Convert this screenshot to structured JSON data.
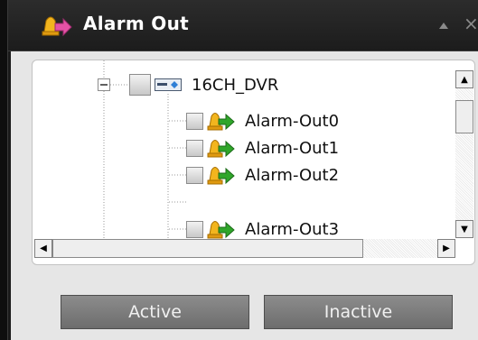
{
  "window": {
    "title": "Alarm Out",
    "collapse_icon": "triangle-up-icon",
    "close_icon": "close-icon",
    "close_glyph": "×"
  },
  "tree": {
    "root": {
      "label": "16CH_DVR",
      "icon": "dvr-device-icon",
      "expander": "collapse-minus-icon"
    },
    "children": [
      {
        "label": "Alarm-Out0",
        "icon": "alarm-out-icon"
      },
      {
        "label": "Alarm-Out1",
        "icon": "alarm-out-icon"
      },
      {
        "label": "Alarm-Out2",
        "icon": "alarm-out-icon"
      },
      {
        "label": "Alarm-Out3",
        "icon": "alarm-out-icon"
      }
    ]
  },
  "buttons": {
    "active": "Active",
    "inactive": "Inactive"
  },
  "colors": {
    "title_bar": "#1c1c1c",
    "panel": "#e6e6e6",
    "button": "#7d7d7d",
    "alarm_arrow": "#2fa62a",
    "bell": "#f0b020"
  }
}
